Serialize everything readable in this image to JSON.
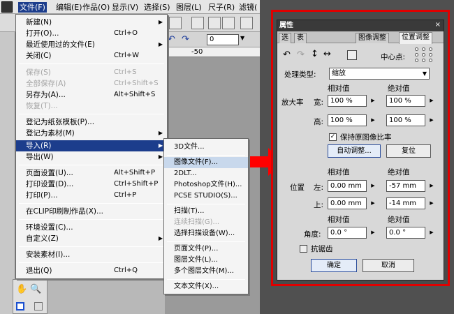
{
  "menubar": {
    "items": [
      "文件(F)",
      "编辑(E)",
      "作品(O)",
      "显示(V)",
      "选择(S)",
      "图层(L)",
      "尺子(R)",
      "滤镜("
    ]
  },
  "toolbar": {
    "zoom_value": "0",
    "ruler_mark": "-50",
    "side_label": "作"
  },
  "file_menu": {
    "items": [
      {
        "label": "新建(N)",
        "shortcut": "",
        "arrow": "▶",
        "disabled": false
      },
      {
        "label": "打开(O)...",
        "shortcut": "Ctrl+O",
        "arrow": "",
        "disabled": false
      },
      {
        "label": "最近使用过的文件(E)",
        "shortcut": "",
        "arrow": "▶",
        "disabled": false
      },
      {
        "label": "关闭(C)",
        "shortcut": "Ctrl+W",
        "arrow": "",
        "disabled": false
      },
      {
        "label": "保存(S)",
        "shortcut": "Ctrl+S",
        "arrow": "",
        "disabled": true
      },
      {
        "label": "全部保存(A)",
        "shortcut": "Ctrl+Shift+S",
        "arrow": "",
        "disabled": true
      },
      {
        "label": "另存为(A)...",
        "shortcut": "Alt+Shift+S",
        "arrow": "",
        "disabled": false
      },
      {
        "label": "恢复(T)...",
        "shortcut": "",
        "arrow": "",
        "disabled": true
      },
      {
        "label": "登记为纸张模板(P)...",
        "shortcut": "",
        "arrow": "",
        "disabled": false
      },
      {
        "label": "登记为素材(M)",
        "shortcut": "",
        "arrow": "▶",
        "disabled": false
      },
      {
        "label": "导入(R)",
        "shortcut": "",
        "arrow": "▶",
        "disabled": false
      },
      {
        "label": "导出(W)",
        "shortcut": "",
        "arrow": "▶",
        "disabled": false
      },
      {
        "label": "页面设置(U)...",
        "shortcut": "Alt+Shift+P",
        "arrow": "",
        "disabled": false
      },
      {
        "label": "打印设置(D)...",
        "shortcut": "Ctrl+Shift+P",
        "arrow": "",
        "disabled": false
      },
      {
        "label": "打印(P)...",
        "shortcut": "Ctrl+P",
        "arrow": "",
        "disabled": false
      },
      {
        "label": "在CLIP印刷制作品(X)...",
        "shortcut": "",
        "arrow": "",
        "disabled": false
      },
      {
        "label": "环境设置(C)...",
        "shortcut": "",
        "arrow": "",
        "disabled": false
      },
      {
        "label": "自定义(Z)",
        "shortcut": "",
        "arrow": "▶",
        "disabled": false
      },
      {
        "label": "安装素材(I)...",
        "shortcut": "",
        "arrow": "",
        "disabled": false
      },
      {
        "label": "退出(Q)",
        "shortcut": "Ctrl+Q",
        "arrow": "",
        "disabled": false
      }
    ]
  },
  "import_submenu": {
    "items": [
      {
        "label": "3D文件...",
        "disabled": false
      },
      {
        "label": "图像文件(F)...",
        "disabled": false
      },
      {
        "label": "2DLT...",
        "disabled": false
      },
      {
        "label": "Photoshop文件(H)...",
        "disabled": false
      },
      {
        "label": "PCSE STUDIO(S)...",
        "disabled": false
      },
      {
        "label": "扫描(T)...",
        "disabled": false
      },
      {
        "label": "连续扫描(G)...",
        "disabled": true
      },
      {
        "label": "选择扫描设备(W)...",
        "disabled": false
      },
      {
        "label": "页面文件(P)...",
        "disabled": false
      },
      {
        "label": "图层文件(L)...",
        "disabled": false
      },
      {
        "label": "多个图层文件(M)...",
        "disabled": false
      },
      {
        "label": "文本文件(X)...",
        "disabled": false
      }
    ]
  },
  "palette": {
    "title": "属性",
    "tabs": [
      "选",
      "表",
      "图像调整",
      "位置调整"
    ],
    "center_point_label": "中心点:",
    "process_type_label": "处理类型:",
    "process_type_value": "缩放",
    "relative_label": "相对值",
    "absolute_label": "绝对值",
    "scale_label": "放大率",
    "width_label": "宽:",
    "height_label": "高:",
    "width_rel": "100 %",
    "width_abs": "100 %",
    "height_rel": "100 %",
    "height_abs": "100 %",
    "keep_ratio_label": "保持原图像比率",
    "keep_ratio_checked": "✓",
    "auto_adjust_label": "自动调整...",
    "reset_label": "复位",
    "position_label": "位置",
    "left_label": "左:",
    "top_label": "上:",
    "left_rel": "0.00 mm",
    "left_abs": "-57 mm",
    "top_rel": "0.00 mm",
    "top_abs": "-14 mm",
    "angle_label": "角度:",
    "angle_rel": "0.0 °",
    "angle_abs": "0.0 °",
    "antialias_label": "抗锯齿",
    "ok_label": "确定",
    "cancel_label": "取消"
  },
  "colors": {
    "highlight": "#1c3d8c",
    "frame": "#e00000",
    "arrow": "#ff0000"
  }
}
